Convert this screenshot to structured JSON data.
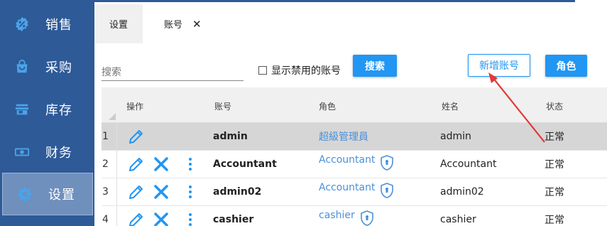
{
  "sidebar": {
    "items": [
      {
        "label": "销售",
        "icon": "sales-icon"
      },
      {
        "label": "采购",
        "icon": "shopping-bag-icon"
      },
      {
        "label": "库存",
        "icon": "store-icon"
      },
      {
        "label": "财务",
        "icon": "money-icon"
      },
      {
        "label": "设置",
        "icon": "gear-icon",
        "active": true
      }
    ]
  },
  "tabs": [
    {
      "label": "设置"
    },
    {
      "label": "账号",
      "close": "✕"
    }
  ],
  "toolbar": {
    "search_placeholder": "搜索",
    "show_disabled_label": "显示禁用的账号",
    "search_button": "搜索",
    "new_account_button": "新增账号",
    "role_button": "角色"
  },
  "table": {
    "columns": [
      "操作",
      "账号",
      "角色",
      "姓名",
      "状态"
    ],
    "rows": [
      {
        "num": "1",
        "account": "admin",
        "role": "超級管理員",
        "name": "admin",
        "status": "正常"
      },
      {
        "num": "2",
        "account": "Accountant",
        "role": "Accountant",
        "name": "Accountant",
        "status": "正常"
      },
      {
        "num": "3",
        "account": "admin02",
        "role": "Accountant",
        "name": "admin02",
        "status": "正常"
      },
      {
        "num": "4",
        "account": "cashier",
        "role": "cashier",
        "name": "cashier",
        "status": "正常"
      }
    ]
  },
  "colors": {
    "sidebar": "#2e5a97",
    "accent": "#2196f3",
    "role_link": "#4a90d9",
    "annotation_arrow": "#e53935"
  }
}
